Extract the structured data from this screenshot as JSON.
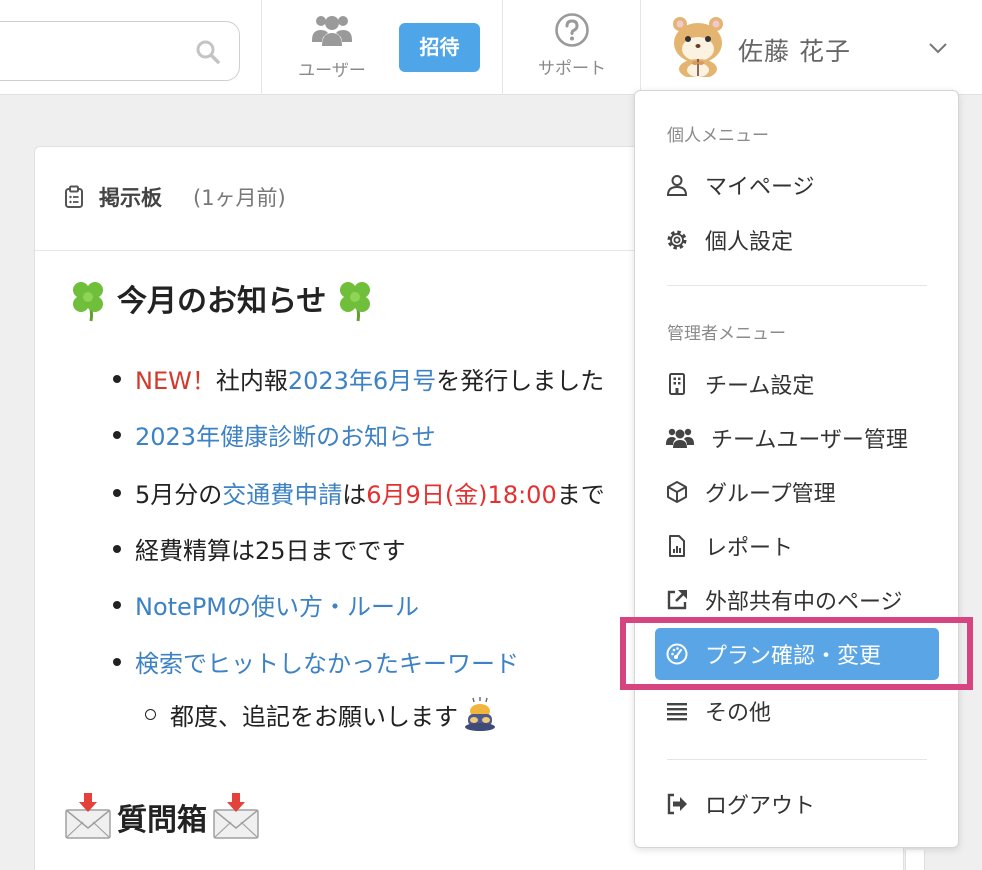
{
  "header": {
    "users_label": "ユーザー",
    "invite_label": "招待",
    "support_label": "サポート",
    "user_name": "佐藤 花子"
  },
  "board": {
    "title": "掲示板",
    "subtitle": "(1ヶ月前)",
    "section1_title": "今月のお知らせ",
    "bullets": {
      "b1_new": "NEW！",
      "b1_text": "社内報",
      "b1_link": "2023年6月号",
      "b1_rest": "を発行しました",
      "b2_link": "2023年健康診断のお知らせ",
      "b3_pre": "5月分の",
      "b3_link": "交通費申請",
      "b3_mid": "は",
      "b3_date": "6月9日(金)18:00",
      "b3_rest": "まで",
      "b4_text": "経費精算は25日までです",
      "b5_link": "NotePMの使い方・ルール",
      "b6_link": "検索でヒットしなかったキーワード",
      "b6_sub": "都度、追記をお願いします"
    },
    "section2_title": "質問箱"
  },
  "menu": {
    "personal_header": "個人メニュー",
    "mypage": "マイページ",
    "personal_settings": "個人設定",
    "admin_header": "管理者メニュー",
    "team_settings": "チーム設定",
    "team_users": "チームユーザー管理",
    "group_mgmt": "グループ管理",
    "report": "レポート",
    "external_share": "外部共有中のページ",
    "plan": "プラン確認・変更",
    "other": "その他",
    "logout": "ログアウト"
  },
  "colors": {
    "accent": "#4ea6e8",
    "menu_active": "#5aa5e6",
    "highlight": "#d6457f",
    "link": "#3c82c4",
    "red": "#d33a2c"
  }
}
